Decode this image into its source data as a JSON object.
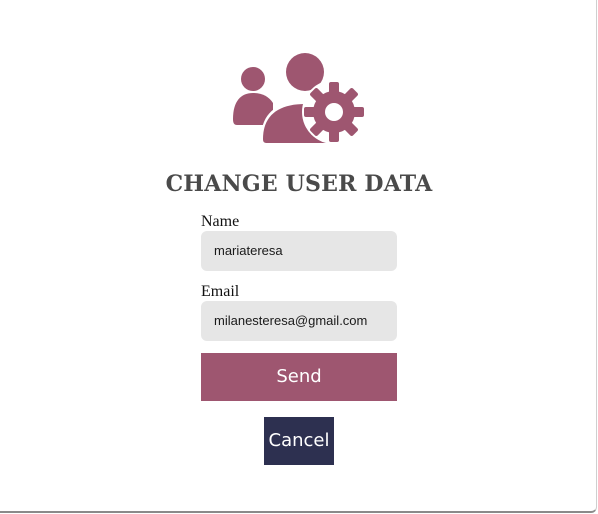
{
  "page": {
    "title": "CHANGE USER DATA",
    "icon": "users-gear-icon",
    "accent_color": "#9e5670",
    "secondary_color": "#2d3050"
  },
  "form": {
    "name_label": "Name",
    "name_value": "mariateresa",
    "email_label": "Email",
    "email_value": "milanesteresa@gmail.com",
    "send_label": "Send",
    "cancel_label": "Cancel"
  }
}
